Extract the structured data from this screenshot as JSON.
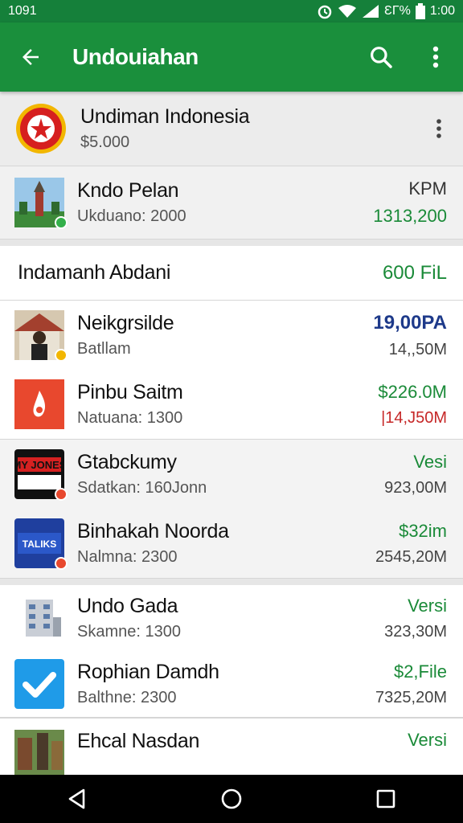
{
  "status_bar": {
    "time_left": "1091",
    "battery_text": "ƐΓ%",
    "clock": "1:00"
  },
  "app_bar": {
    "title": "Undouiahan"
  },
  "featured": {
    "name": "Undiman Indonesia",
    "price": "$5.000"
  },
  "top_item": {
    "name": "Kndo Pelan",
    "sub": "Ukduano: 2000",
    "right_top": "KPM",
    "right_bottom": "1313,200"
  },
  "section": {
    "title": "Indamanh Abdani",
    "right": "600 FiL"
  },
  "items": [
    {
      "name": "Neikgrsilde",
      "sub": "Batllam",
      "r1": "19,00PA",
      "r2": "14,,50M"
    },
    {
      "name": "Pinbu Saitm",
      "sub": "Natuana: 1300",
      "r1": "$226.0M",
      "r2": "|14,J50M"
    },
    {
      "name": "Gtabckumy",
      "sub": "Sdatkan: 160Jonn",
      "r1": "Vesi",
      "r2": "923,00M"
    },
    {
      "name": "Binhakah Noorda",
      "sub": "Nalmna: 2300",
      "r1": "$32im",
      "r2": "2545,20M"
    },
    {
      "name": "Undo Gada",
      "sub": "Skamne: 1300",
      "r1": "Versi",
      "r2": "323,30M"
    },
    {
      "name": "Rophian Damdh",
      "sub": "Balthne: 2300",
      "r1": "$2,File",
      "r2": "7325,20M"
    },
    {
      "name": "Ehcal Nasdan",
      "sub": "",
      "r1": "Versi",
      "r2": ""
    }
  ],
  "thumb_text": {
    "item3": "MY JONES",
    "item4": "TALIKS"
  },
  "colors": {
    "primary": "#1a8f3c",
    "status": "#15803a",
    "accent_green": "#1a8a38",
    "accent_blue": "#1e3a8a",
    "accent_red": "#c62828"
  },
  "icons": [
    "back-arrow-icon",
    "search-icon",
    "more-vert-icon",
    "wifi-icon",
    "signal-icon",
    "battery-icon",
    "alarm-icon",
    "nav-back-icon",
    "nav-home-icon",
    "nav-recents-icon"
  ]
}
